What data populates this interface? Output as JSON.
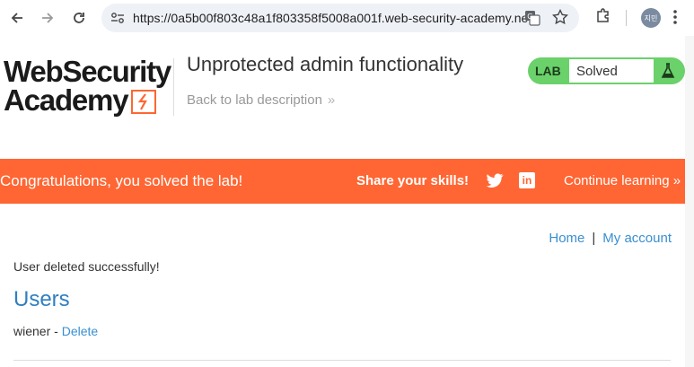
{
  "browser": {
    "url": "https://0a5b00f803c48a1f803358f5008a001f.web-security-academy.ne...",
    "profile_initials": "지민"
  },
  "header": {
    "logo_line1": "WebSecurity",
    "logo_line2": "Academy",
    "lab_title": "Unprotected admin functionality",
    "back_link": "Back to lab description",
    "back_chevron": "»",
    "lab_badge": "LAB",
    "lab_status": "Solved"
  },
  "banner": {
    "message": "Congratulations, you solved the lab!",
    "share_label": "Share your skills!",
    "linkedin_glyph": "in",
    "continue_label": "Continue learning »"
  },
  "nav": {
    "home": "Home",
    "separator": "|",
    "account": "My account"
  },
  "main": {
    "message": "User deleted successfully!",
    "heading": "Users",
    "users": [
      {
        "name": "wiener",
        "separator": " - ",
        "action": "Delete"
      }
    ]
  },
  "colors": {
    "accent_orange": "#ff6633",
    "lab_green": "#6bd16b",
    "link_blue": "#3a8fd0",
    "heading_blue": "#2f7fc1"
  },
  "icons": [
    "back-arrow-icon",
    "forward-arrow-icon",
    "reload-icon",
    "site-info-icon",
    "translate-icon",
    "star-icon",
    "extensions-icon",
    "more-menu-icon",
    "flask-icon",
    "twitter-icon",
    "linkedin-icon"
  ]
}
